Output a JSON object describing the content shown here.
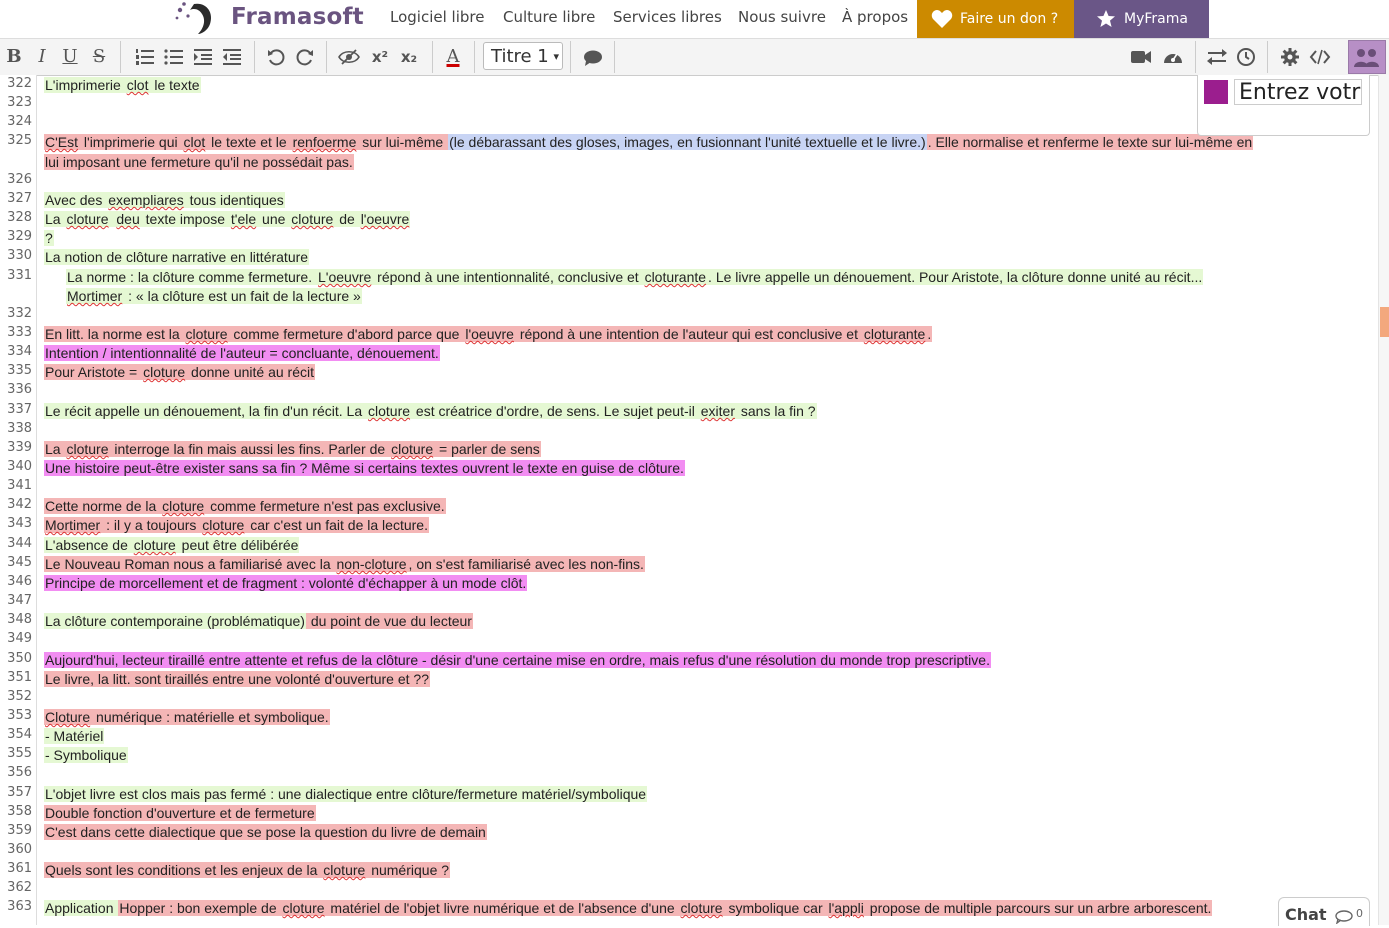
{
  "nav": {
    "brand": "Framasoft",
    "links": [
      "Logiciel libre",
      "Culture libre",
      "Services libres",
      "Nous suivre",
      "À propos"
    ],
    "donate": "Faire un don ?",
    "myframa": "MyFrama"
  },
  "toolbar": {
    "bold": "B",
    "italic": "I",
    "underline": "U",
    "strike": "S",
    "superscript": "x²",
    "subscript": "x₂",
    "color_letter": "A",
    "heading_value": "Titre 1"
  },
  "users": {
    "color": "#9b1e8e",
    "name_placeholder": "Entrez votr"
  },
  "chat": {
    "label": "Chat",
    "count": "0"
  },
  "editor": {
    "lines": [
      {
        "n": "322",
        "segs": [
          [
            "L'imprimerie ",
            "g"
          ],
          [
            "clot",
            "g sp"
          ],
          [
            " le texte",
            "g"
          ]
        ]
      },
      {
        "n": "323",
        "segs": []
      },
      {
        "n": "324",
        "segs": []
      },
      {
        "n": "325",
        "segs": [
          [
            "C'Est",
            "r sp"
          ],
          [
            " l'imprimerie qui ",
            "r"
          ],
          [
            "clot",
            "r sp"
          ],
          [
            " le texte et le ",
            "r"
          ],
          [
            "renfoerme",
            "r sp"
          ],
          [
            " sur lui-même ",
            "r"
          ],
          [
            "(le débarassant des gloses, images, en fusionnant l'unité textuelle et le livre.)",
            "b"
          ],
          [
            ". Elle normalise et renferme le texte sur lui-même en",
            "r"
          ]
        ]
      },
      {
        "n": "",
        "segs": [
          [
            "lui imposant une fermeture qu'il ne possédait pas. ",
            "r"
          ]
        ]
      },
      {
        "n": "326",
        "segs": []
      },
      {
        "n": "327",
        "segs": [
          [
            "Avec des ",
            "g"
          ],
          [
            "exempliares",
            "g sp"
          ],
          [
            " tous identiques",
            "g"
          ]
        ]
      },
      {
        "n": "328",
        "segs": [
          [
            "La ",
            "g"
          ],
          [
            "cloture",
            "g sp"
          ],
          [
            " ",
            "g"
          ],
          [
            "deu",
            "g sp"
          ],
          [
            " texte impose  ",
            "g"
          ],
          [
            "t'ele",
            "g sp"
          ],
          [
            " une ",
            "g"
          ],
          [
            "cloture",
            "g sp"
          ],
          [
            " de ",
            "g"
          ],
          [
            "l'oeuvre",
            "g sp"
          ]
        ]
      },
      {
        "n": "329",
        "segs": [
          [
            " ?",
            "g"
          ]
        ]
      },
      {
        "n": "330",
        "segs": [
          [
            "La notion de clôture narrative en littérature",
            "g"
          ]
        ]
      },
      {
        "n": "331",
        "indent": true,
        "segs": [
          [
            "La norme : la clôture comme fermeture. ",
            "g"
          ],
          [
            "L'oeuvre",
            "g sp"
          ],
          [
            " répond à une intentionnalité, conclusive et ",
            "g"
          ],
          [
            "cloturante",
            "g sp"
          ],
          [
            ". Le livre appelle un dénouement. Pour Aristote, la clôture donne unité au récit...",
            "g"
          ]
        ]
      },
      {
        "n": "",
        "indent": true,
        "segs": [
          [
            "Mortimer",
            "g sp"
          ],
          [
            " : « la clôture est un fait de la lecture »",
            "g"
          ]
        ]
      },
      {
        "n": "332",
        "segs": []
      },
      {
        "n": "333",
        "segs": [
          [
            "En litt. la norme est la ",
            "r"
          ],
          [
            "cloture",
            "r sp"
          ],
          [
            " comme fermeture d'abord parce que ",
            "r"
          ],
          [
            "l'oeuvre",
            "r sp"
          ],
          [
            " répond à une intention de l'auteur qui est conclusive et ",
            "r"
          ],
          [
            "cloturante",
            "r sp"
          ],
          [
            ". ",
            "r"
          ]
        ]
      },
      {
        "n": "334",
        "segs": [
          [
            "Intention / intentionnalité de l'auteur = concluante, dénouement. ",
            "m"
          ]
        ]
      },
      {
        "n": "335",
        "segs": [
          [
            "Pour Aristote = ",
            "r"
          ],
          [
            "cloture",
            "r sp"
          ],
          [
            " donne unité au récit",
            "r"
          ]
        ]
      },
      {
        "n": "336",
        "segs": []
      },
      {
        "n": "337",
        "segs": [
          [
            "Le récit appelle un dénouement, la fin d'un récit. La ",
            "g"
          ],
          [
            "cloture",
            "g sp"
          ],
          [
            " est créatrice d'ordre, de sens. Le sujet peut-il ",
            "g"
          ],
          [
            "exiter",
            "g sp"
          ],
          [
            " sans la fin ?",
            "g"
          ]
        ]
      },
      {
        "n": "338",
        "segs": []
      },
      {
        "n": "339",
        "segs": [
          [
            "La ",
            "r"
          ],
          [
            "cloture",
            "r sp"
          ],
          [
            " interroge la fin mais aussi les fins. Parler de ",
            "r"
          ],
          [
            "cloture",
            "r sp"
          ],
          [
            " = parler de sens",
            "r"
          ]
        ]
      },
      {
        "n": "340",
        "segs": [
          [
            "Une histoire peut-être exister sans sa fin ? Même si certains textes ouvrent le texte en guise de clôture.",
            "m"
          ]
        ]
      },
      {
        "n": "341",
        "segs": []
      },
      {
        "n": "342",
        "segs": [
          [
            "Cette norme de la ",
            "r"
          ],
          [
            "cloture",
            "r sp"
          ],
          [
            " comme fermeture n'est pas exclusive. ",
            "r"
          ]
        ]
      },
      {
        "n": "343",
        "segs": [
          [
            "Mortimer",
            "r sp"
          ],
          [
            " : il y a toujours ",
            "r"
          ],
          [
            "cloture",
            "r sp"
          ],
          [
            " car c'est un fait de la lecture. ",
            "r"
          ]
        ]
      },
      {
        "n": "344",
        "segs": [
          [
            "L'absence de ",
            "g"
          ],
          [
            "cloture",
            "g sp"
          ],
          [
            " peut être délibérée",
            "g"
          ]
        ]
      },
      {
        "n": "345",
        "segs": [
          [
            "Le Nouveau Roman nous a familiarisé avec la ",
            "r"
          ],
          [
            "non-cloture",
            "r sp"
          ],
          [
            ", on s'est familiarisé avec les non-fins. ",
            "r"
          ]
        ]
      },
      {
        "n": "346",
        "segs": [
          [
            "Principe de morcellement et de fragment : volonté d'échapper à un mode clôt. ",
            "m"
          ]
        ]
      },
      {
        "n": "347",
        "segs": []
      },
      {
        "n": "348",
        "segs": [
          [
            "La clôture contemporaine (problématique)",
            "g"
          ],
          [
            " du point de vue du lecteur",
            "r"
          ]
        ]
      },
      {
        "n": "349",
        "segs": []
      },
      {
        "n": "350",
        "segs": [
          [
            "Aujourd'hui, lecteur tiraillé entre attente et refus de la clôture - désir d'une certaine mise en ordre, mais refus d'une résolution du monde trop prescriptive. ",
            "m"
          ]
        ]
      },
      {
        "n": "351",
        "segs": [
          [
            "Le livre, la litt. sont tiraillés entre une volonté d'ouverture et ??",
            "r"
          ]
        ]
      },
      {
        "n": "352",
        "segs": []
      },
      {
        "n": "353",
        "segs": [
          [
            "Cloture",
            "r sp"
          ],
          [
            " numérique : matérielle et symbolique. ",
            "r"
          ]
        ]
      },
      {
        "n": "354",
        "segs": [
          [
            "- Matériel",
            "g"
          ]
        ]
      },
      {
        "n": "355",
        "segs": [
          [
            "- Symbolique",
            "g"
          ]
        ]
      },
      {
        "n": "356",
        "segs": []
      },
      {
        "n": "357",
        "segs": [
          [
            "L'objet livre est clos mais pas fermé : une dialectique entre clôture/fermeture matériel/symbolique",
            "g"
          ]
        ]
      },
      {
        "n": "358",
        "segs": [
          [
            "Double fonction d'ouverture et de fermeture ",
            "r"
          ]
        ]
      },
      {
        "n": "359",
        "segs": [
          [
            "C'est dans cette dialectique que se pose la question du livre de demain ",
            "r"
          ]
        ]
      },
      {
        "n": "360",
        "segs": []
      },
      {
        "n": "361",
        "segs": [
          [
            "Quels sont les conditions et les enjeux de la ",
            "r"
          ],
          [
            "cloture",
            "r sp"
          ],
          [
            " numérique ? ",
            "r"
          ]
        ]
      },
      {
        "n": "362",
        "segs": []
      },
      {
        "n": "363",
        "segs": [
          [
            "Application ",
            "g"
          ],
          [
            "Hopper : bon exemple de ",
            "r"
          ],
          [
            "cloture",
            "r sp"
          ],
          [
            " matériel de l'objet livre numérique et de l'absence d'une ",
            "r"
          ],
          [
            "cloture",
            "r sp"
          ],
          [
            " symbolique car ",
            "r"
          ],
          [
            "l'appli",
            "r sp"
          ],
          [
            " propose de multiple parcours sur un arbre arborescent. ",
            "r"
          ]
        ]
      }
    ]
  }
}
